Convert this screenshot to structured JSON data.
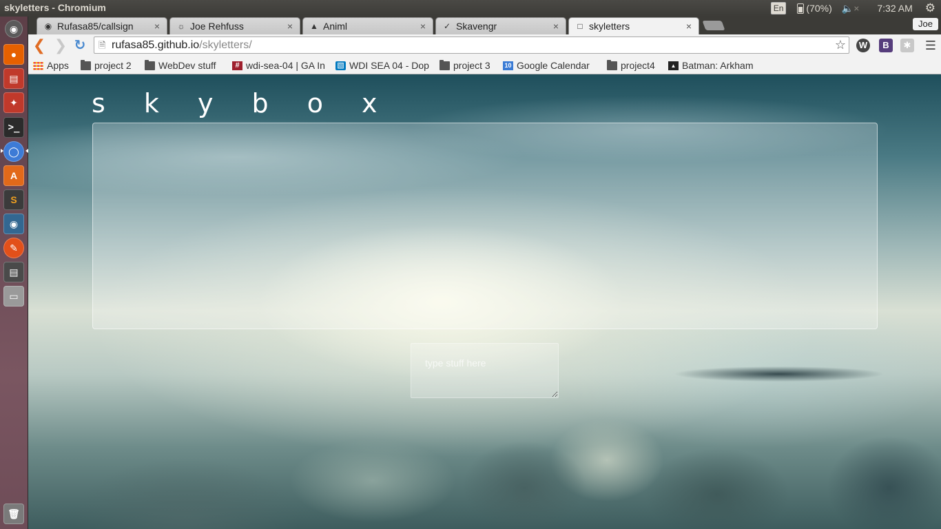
{
  "system": {
    "window_title": "skyletters - Chromium",
    "keyboard_layout": "En",
    "battery": "(70%)",
    "clock": "7:32 AM"
  },
  "browser": {
    "tabs": [
      {
        "title": "Rufasa85/callsign",
        "icon": "github-icon"
      },
      {
        "title": "Joe Rehfuss",
        "icon": "web-icon"
      },
      {
        "title": "Animl",
        "icon": "penguin-icon"
      },
      {
        "title": "Skavengr",
        "icon": "feather-icon"
      },
      {
        "title": "skyletters",
        "icon": "page-icon",
        "active": true
      }
    ],
    "profile_name": "Joe",
    "url_host": "rufasa85.github.io",
    "url_path": "/skyletters/",
    "bookmarks": [
      {
        "label": "Apps",
        "icon": "apps-grid-icon"
      },
      {
        "label": "project 2",
        "icon": "folder-icon"
      },
      {
        "label": "WebDev stuff",
        "icon": "folder-icon"
      },
      {
        "label": "wdi-sea-04 | GA In",
        "icon": "slack-icon"
      },
      {
        "label": "WDI SEA 04 - Dop",
        "icon": "trello-icon"
      },
      {
        "label": "project 3",
        "icon": "folder-icon"
      },
      {
        "label": "Google Calendar",
        "icon": "calendar-icon"
      },
      {
        "label": "project4",
        "icon": "folder-icon"
      },
      {
        "label": "Batman: Arkham",
        "icon": "batman-icon"
      }
    ],
    "extensions": [
      "W",
      "B"
    ]
  },
  "page": {
    "title": "s k y b o x",
    "input_placeholder": "type stuff here",
    "input_value": ""
  },
  "colors": {
    "chrome_bg": "#f2f2f2",
    "panel_bg": "#3c3b37",
    "launcher_bg": "#6a4a55",
    "back_arrow": "#e06c24",
    "reload": "#4a8ad0"
  }
}
